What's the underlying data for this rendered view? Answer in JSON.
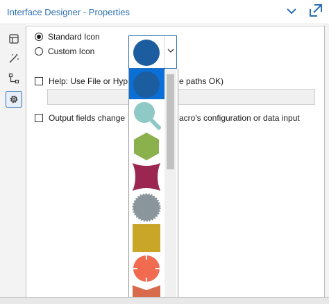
{
  "window": {
    "title": "Interface Designer - Properties"
  },
  "header_icons": [
    "chevron-down-icon",
    "pop-out-icon"
  ],
  "sidebar": [
    {
      "name": "layout-view",
      "icon": "layout-icon",
      "active": false
    },
    {
      "name": "actions-view",
      "icon": "magic-wand-icon",
      "active": false
    },
    {
      "name": "tree-view",
      "icon": "tree-icon",
      "active": false
    },
    {
      "name": "properties-view",
      "icon": "gear-icon",
      "active": true
    }
  ],
  "icon_choice": {
    "standard_label": "Standard Icon",
    "custom_label": "Custom Icon",
    "selected": "Standard Icon"
  },
  "help": {
    "label": "Help: Use File or Hyp",
    "label_tail": "e paths OK)",
    "value": "",
    "checked": false
  },
  "output_fields": {
    "label": "Output fields change",
    "label_tail": "acro's configuration or data input",
    "checked": false
  },
  "icon_dropdown": {
    "selected_icon": "blue-circle-icon",
    "options": [
      {
        "icon": "blue-circle-icon",
        "color": "#1b5d9e",
        "selected": true
      },
      {
        "icon": "magnifier-icon",
        "color": "#8fc9c5",
        "selected": false
      },
      {
        "icon": "hexagon-icon",
        "color": "#8bb14d",
        "selected": false
      },
      {
        "icon": "concave-square-icon",
        "color": "#9b2750",
        "selected": false
      },
      {
        "icon": "gear-badge-icon",
        "color": "#8a969c",
        "selected": false
      },
      {
        "icon": "square-icon",
        "color": "#c9a528",
        "selected": false
      },
      {
        "icon": "notched-circle-icon",
        "color": "#f06b4f",
        "selected": false
      },
      {
        "icon": "ribbon-icon",
        "color": "#d96b4d",
        "selected": false
      }
    ]
  },
  "colors": {
    "accent": "#2c6fb5",
    "selection": "#0a6fd6"
  }
}
